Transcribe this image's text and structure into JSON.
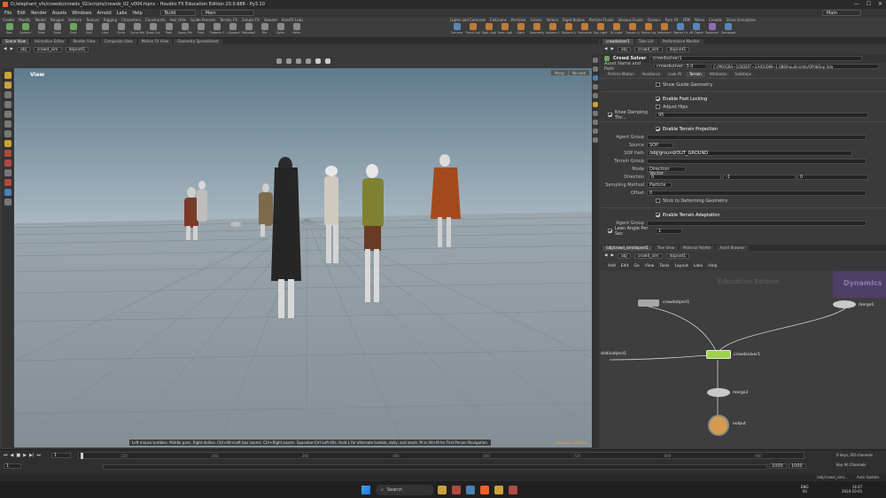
{
  "window": {
    "title": "D:/elephant_vfx/crowds/crowds_02/scripts/crowds_02_v004.hipnc - Houdini FX Education Edition 20.0.688 - Py3.10",
    "controls": [
      "—",
      "☐",
      "✕"
    ]
  },
  "menu": [
    "File",
    "Edit",
    "Render",
    "Assets",
    "Windows",
    "Arnold",
    "Labs",
    "Help"
  ],
  "desktops": {
    "build": "Build",
    "main": "Main",
    "main_right": "Main"
  },
  "shelf": {
    "tabs_left": [
      "Create",
      "Modify",
      "Model",
      "Polygon",
      "Deform",
      "Texture",
      "Rigging",
      "Characters",
      "Constraints",
      "Hair Utils",
      "Guide Process",
      "Terrain FX",
      "Simple FX",
      "Volume",
      "KineFX Labs"
    ],
    "tabs_right": [
      "Lights and Cameras",
      "Collisions",
      "Particles",
      "Grains",
      "Vellum",
      "Rigid Bodies",
      "Particle Fluids",
      "Viscous Fluids",
      "Oceans",
      "Pyro FX",
      "FEM",
      "Wires",
      "Crowds",
      "Drive Simulation"
    ],
    "tools_left": [
      {
        "icon": "box-icon",
        "label": "Box"
      },
      {
        "icon": "sphere-icon",
        "label": "Sphere"
      },
      {
        "icon": "tube-icon",
        "label": "Tube"
      },
      {
        "icon": "torus-icon",
        "label": "Torus"
      },
      {
        "icon": "grid-icon",
        "label": "Grid"
      },
      {
        "icon": "null-icon",
        "label": "Null"
      },
      {
        "icon": "line-icon",
        "label": "Line"
      },
      {
        "icon": "circle-icon",
        "label": "Circle"
      },
      {
        "icon": "curve-bezier-icon",
        "label": "Curve Bezier"
      },
      {
        "icon": "draw-curve-icon",
        "label": "Draw Curve"
      },
      {
        "icon": "path-icon",
        "label": "Path"
      },
      {
        "icon": "spray-paint-icon",
        "label": "Spray Paint"
      },
      {
        "icon": "font-icon",
        "label": "Font"
      },
      {
        "icon": "platonic-icon",
        "label": "Platonic Solids"
      },
      {
        "icon": "lsystem-icon",
        "label": "L-System"
      },
      {
        "icon": "metaball-icon",
        "label": "Metaball"
      },
      {
        "icon": "file-icon",
        "label": "File"
      },
      {
        "icon": "spiral-icon",
        "label": "Spiral"
      },
      {
        "icon": "helix-icon",
        "label": "Helix"
      }
    ],
    "tools_right": [
      {
        "icon": "camera-icon",
        "label": "Camera"
      },
      {
        "icon": "point-light-icon",
        "label": "Point Light"
      },
      {
        "icon": "spot-light-icon",
        "label": "Spot Light"
      },
      {
        "icon": "area-light-icon",
        "label": "Area Light"
      },
      {
        "icon": "light-icon",
        "label": "Light"
      },
      {
        "icon": "geometry-light-icon",
        "label": "Geometry Light"
      },
      {
        "icon": "volume-light-icon",
        "label": "Volume Light"
      },
      {
        "icon": "distant-light-icon",
        "label": "Distant Light"
      },
      {
        "icon": "environment-light-icon",
        "label": "Environment Light"
      },
      {
        "icon": "sky-light-icon",
        "label": "Sky Light"
      },
      {
        "icon": "gi-light-icon",
        "label": "GI Light"
      },
      {
        "icon": "caustic-light-icon",
        "label": "Caustic Light"
      },
      {
        "icon": "portal-light-icon",
        "label": "Portal Light"
      },
      {
        "icon": "ambient-light-icon",
        "label": "Ambient Light"
      },
      {
        "icon": "stereo-camera-icon",
        "label": "Stereo Camera"
      },
      {
        "icon": "vr-camera-icon",
        "label": "VR Camera"
      },
      {
        "icon": "switcher-icon",
        "label": "Switcher"
      },
      {
        "icon": "gamepad-camera-icon",
        "label": "Gamepad Camera"
      }
    ]
  },
  "left_tabs": [
    "Scene View",
    "Animation Editor",
    "Render View",
    "Composite View",
    "Motion FX View",
    "Geometry Spreadsheet"
  ],
  "left_path": [
    "obj",
    "crowd_sim",
    "dopnet1"
  ],
  "viewport": {
    "label": "View",
    "persp": "Persp",
    "cam": "No cam",
    "hint": "Left mouse tumbles. Middle pans. Right dollies. Ctrl+Alt+Left box zooms. Ctrl+Right zooms. Spacebar-Ctrl-Left tilts. Hold L for alternate tumble, dolly, and zoom. M or Alt+M for First Person Navigation.",
    "edition": "Education Edition"
  },
  "param_tabs_top": [
    "crowdsolver1",
    "Take List",
    "Performance Monitor"
  ],
  "param_path": [
    "obj",
    "crowd_sim",
    "dopnet1"
  ],
  "param": {
    "node_type": "Crowd Solver",
    "node_name": "crowdsolver1",
    "asset_label": "Asset Name and Path",
    "asset_name": "crowdsolver::3.0",
    "asset_path": "C:/PROGRA~1/SIDEFF~1/HOUDIN~1.688/houdini/otls/OPlibDop.hda",
    "tabs": [
      "Particle Motion",
      "Avoidance",
      "Look At",
      "Terrain",
      "Attributes",
      "Substeps"
    ],
    "active_tab": "Terrain",
    "show_guide": "Show Guide Geometry",
    "foot_locking": "Enable Foot Locking",
    "adjust_hips": "Adjust Hips",
    "knee_label": "Knee Damping Thr...",
    "knee_value": "95",
    "projection": "Enable Terrain Projection",
    "agent_group": "Agent Group",
    "source_label": "Source",
    "source_value": "SOP",
    "sop_label": "SOP Path",
    "sop_value": "/obj/ground/OUT_GROUND",
    "terrain_group": "Terrain Group",
    "mode_label": "Mode",
    "mode_value": "Direction Vector",
    "direction_label": "Direction",
    "direction_values": [
      "0",
      "-1",
      "0"
    ],
    "sampling_label": "Sampling Method",
    "sampling_value": "Particle",
    "offset_label": "Offset",
    "offset_value": "0",
    "stick": "Stick to Deforming Geometry",
    "adaptation": "Enable Terrain Adaptation",
    "agent_group2": "Agent Group",
    "lean_label": "Lean Angle Per Sec",
    "lean_value": "1"
  },
  "network_tabs": [
    "/obj/crowd_sim/dopnet1",
    "Tree View",
    "Material Palette",
    "Asset Browser"
  ],
  "network_path": [
    "obj",
    "crowd_sim",
    "dopnet1"
  ],
  "network_menu": [
    "Add",
    "Edit",
    "Go",
    "View",
    "Tools",
    "Layout",
    "Labs",
    "Help"
  ],
  "network": {
    "watermark": "Education Edition",
    "context": "Dynamics",
    "nodes": {
      "crowdobject": "crowdobject1",
      "merge1": "merge1",
      "staticobject": "staticobject1",
      "crowdsolver": "crowdsolver1",
      "merge3": "merge3",
      "output": "output"
    }
  },
  "timeline": {
    "frame": "1",
    "start": "1",
    "end": "1000",
    "end2": "1000",
    "ticks": [
      "120",
      "240",
      "360",
      "480",
      "600",
      "720",
      "840",
      "960"
    ],
    "keys": "0 keys, 0/0 channels",
    "key_all": "Key All Channels",
    "path": "/obj/crowd_sim/...",
    "auto_update": "Auto Update"
  },
  "taskbar": {
    "search": "Search",
    "lang": "ENG",
    "lang2": "SV",
    "time": "14:47",
    "date": "2024-10-01"
  }
}
